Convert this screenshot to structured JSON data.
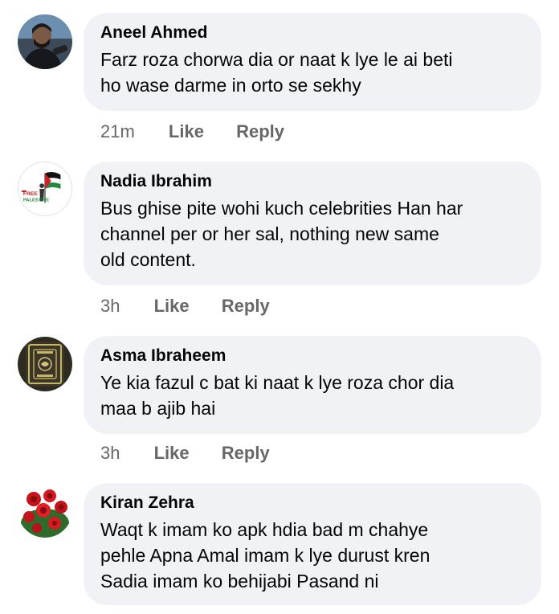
{
  "comments": [
    {
      "author": "Aneel Ahmed",
      "text": "Farz roza chorwa dia or naat k lye le ai beti\nho wase darme in orto se sekhy",
      "time": "21m",
      "like_label": "Like",
      "reply_label": "Reply",
      "avatar": "profile-photo-man"
    },
    {
      "author": "Nadia Ibrahim",
      "text": "Bus ghise pite wohi kuch celebrities Han har\nchannel per or her sal, nothing new same\nold content.",
      "time": "3h",
      "like_label": "Like",
      "reply_label": "Reply",
      "avatar": "free-palestine-flag",
      "avatar_text": "FREE PALESTINE"
    },
    {
      "author": "Asma Ibraheem",
      "text": "Ye kia fazul c  bat ki naat k lye roza chor dia\nmaa b ajib hai",
      "time": "3h",
      "like_label": "Like",
      "reply_label": "Reply",
      "avatar": "quran-book"
    },
    {
      "author": "Kiran Zehra",
      "text": "Waqt k imam ko apk hdia bad m chahye\npehle Apna Amal imam k lye durust kren\nSadia imam ko behijabi Pasand ni",
      "avatar": "red-roses"
    }
  ],
  "colors": {
    "bubble_bg": "#f0f2f5",
    "meta_text": "#65676b",
    "body_text": "#050505"
  }
}
